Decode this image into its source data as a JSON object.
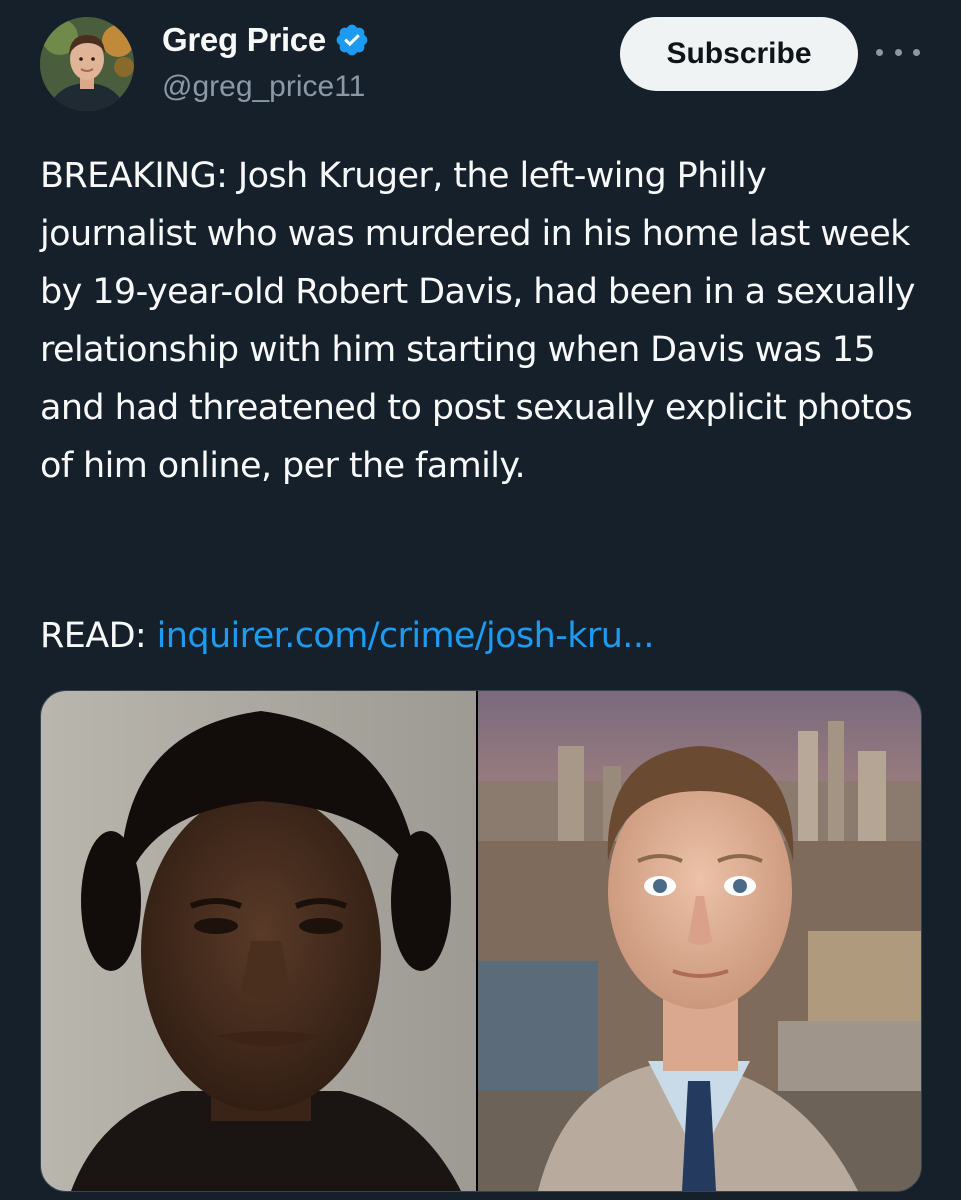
{
  "author": {
    "display_name": "Greg Price",
    "handle": "@greg_price11",
    "verified_icon": "verified-badge-icon"
  },
  "actions": {
    "subscribe_label": "Subscribe",
    "more_icon": "more-options-icon"
  },
  "post": {
    "text": "BREAKING: Josh Kruger, the left-wing Philly journalist who was murdered in his home last week by 19-year-old Robert Davis, had been in a sexually relationship with him starting when Davis was 15 and had threatened to post sexually explicit photos of him online, per the family.",
    "read_prefix": "READ: ",
    "link_text": "inquirer.com/crime/josh-kru..."
  },
  "colors": {
    "background": "#15202b",
    "link": "#1d9bf0",
    "verified": "#1d9bf0",
    "secondary_text": "#8b98a5"
  },
  "media": {
    "images": [
      "mugshot-photo",
      "portrait-photo-city-skyline"
    ]
  }
}
